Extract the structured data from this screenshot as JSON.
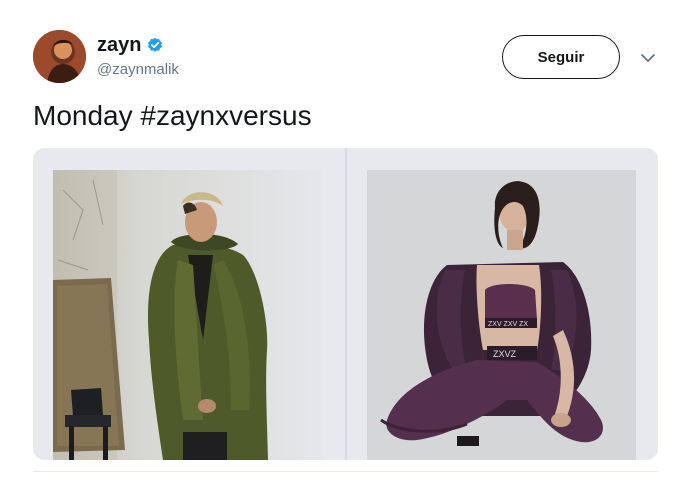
{
  "user": {
    "display_name": "zayn",
    "handle": "@zaynmalik",
    "verified_icon": "verified-badge-icon",
    "avatar_icon": "avatar"
  },
  "actions": {
    "follow_label": "Seguir",
    "menu_icon": "chevron-down-icon"
  },
  "tweet": {
    "text": "Monday #zaynxversus"
  },
  "media": {
    "photos": [
      {
        "name": "photo-zayn-green-coat"
      },
      {
        "name": "photo-model-purple-outfit"
      }
    ],
    "waistband_text": "ZXV ZXV ZX",
    "pants_band_text": "ZXVZ"
  },
  "colors": {
    "verified_blue": "#1da1f2",
    "handle_gray": "#657786",
    "text_dark": "#14171a"
  }
}
